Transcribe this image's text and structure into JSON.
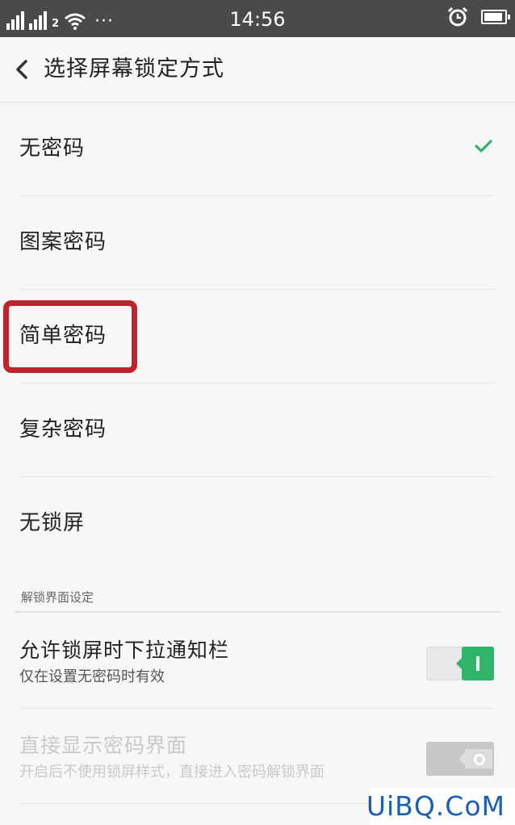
{
  "status_bar": {
    "sim1_label": "ıl",
    "sim2_label": "2",
    "time": "14:56",
    "more": "···",
    "icons": [
      "signal-icon",
      "signal-icon",
      "wifi-icon",
      "alarm-icon",
      "battery-icon"
    ]
  },
  "header": {
    "title": "选择屏幕锁定方式"
  },
  "options": [
    {
      "label": "无密码",
      "selected": true
    },
    {
      "label": "图案密码",
      "selected": false
    },
    {
      "label": "简单密码",
      "selected": false
    },
    {
      "label": "复杂密码",
      "selected": false
    },
    {
      "label": "无锁屏",
      "selected": false
    }
  ],
  "section": {
    "title": "解锁界面设定"
  },
  "settings": [
    {
      "title": "允许锁屏时下拉通知栏",
      "subtitle": "仅在设置无密码时有效",
      "enabled": true,
      "value": "on"
    },
    {
      "title": "直接显示密码界面",
      "subtitle": "开启后不使用锁屏样式，直接进入密码解锁界面",
      "enabled": false,
      "value": "off"
    }
  ],
  "colors": {
    "accent": "#2fb469",
    "status_bar": "#4a4a4a",
    "highlight": "#c0232b",
    "watermark": "#1a5fb4"
  },
  "watermark": "UiBQ.CoM"
}
